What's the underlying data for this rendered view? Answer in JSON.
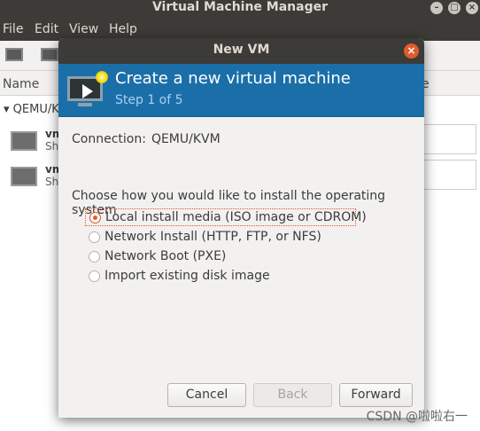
{
  "background_window": {
    "title": "Virtual Machine Manager",
    "menu": [
      "File",
      "Edit",
      "View",
      "Help"
    ],
    "column_name": "Name",
    "column_right_partial": "e",
    "group_label": "QEMU/KV",
    "vms": [
      {
        "name": "vm",
        "state": "Sh"
      },
      {
        "name": "vm",
        "state": "Sh"
      }
    ]
  },
  "dialog": {
    "title": "New VM",
    "banner_title": "Create a new virtual machine",
    "banner_step": "Step 1 of 5",
    "connection_label": "Connection:",
    "connection_value": "QEMU/KVM",
    "question": "Choose how you would like to install the operating system",
    "options": [
      {
        "label": "Local install media (ISO image or CDROM)",
        "selected": true
      },
      {
        "label": "Network Install (HTTP, FTP, or NFS)",
        "selected": false
      },
      {
        "label": "Network Boot (PXE)",
        "selected": false
      },
      {
        "label": "Import existing disk image",
        "selected": false
      }
    ],
    "buttons": {
      "cancel": "Cancel",
      "back": "Back",
      "forward": "Forward"
    }
  },
  "watermark": "CSDN @啦啦右一",
  "colors": {
    "titlebar": "#3c3b37",
    "banner": "#1b6fa8",
    "accent": "#e05b2b"
  }
}
